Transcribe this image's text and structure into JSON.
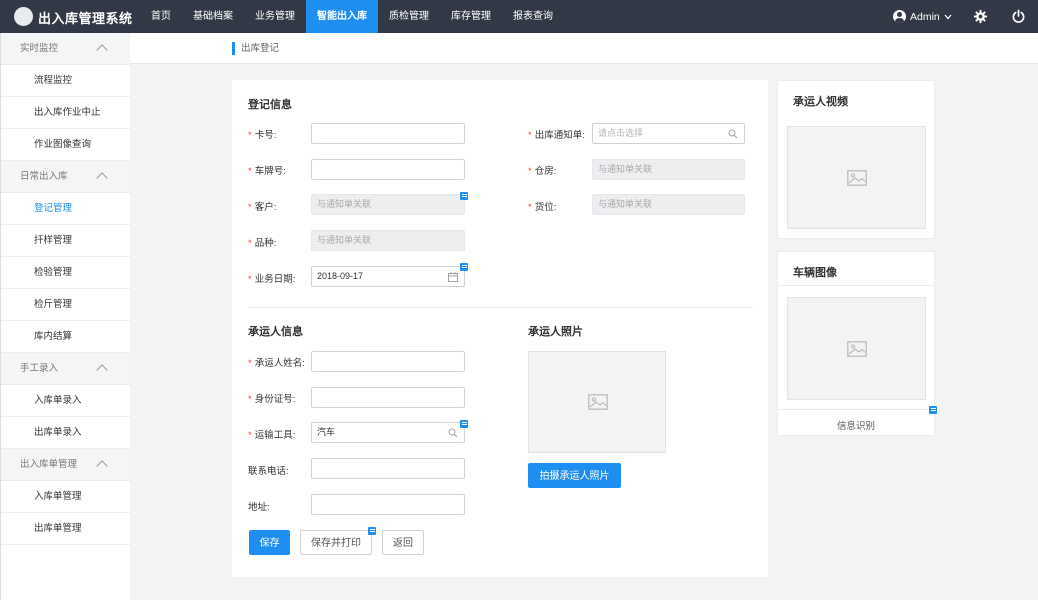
{
  "header": {
    "app_title": "出入库管理系统",
    "nav": [
      {
        "label": "首页",
        "active": false
      },
      {
        "label": "基础档案",
        "active": false
      },
      {
        "label": "业务管理",
        "active": false
      },
      {
        "label": "智能出入库",
        "active": true
      },
      {
        "label": "质检管理",
        "active": false
      },
      {
        "label": "库存管理",
        "active": false
      },
      {
        "label": "报表查询",
        "active": false
      }
    ],
    "user_name": "Admin",
    "user_icon": "user-avatar-icon",
    "settings_icon": "gear-icon",
    "logout_icon": "power-icon"
  },
  "sidebar": {
    "groups": [
      {
        "label": "实时监控",
        "items": [
          "流程监控",
          "出入库作业中止",
          "作业图像查询"
        ]
      },
      {
        "label": "日常出入库",
        "items": [
          "登记管理",
          "扦样管理",
          "检验管理",
          "检斤管理",
          "库内结算"
        ]
      },
      {
        "label": "手工录入",
        "items": [
          "入库单录入",
          "出库单录入"
        ]
      },
      {
        "label": "出入库单管理",
        "items": [
          "入库单管理",
          "出库单管理"
        ]
      }
    ],
    "active_item": "登记管理"
  },
  "breadcrumb": "出库登记",
  "form": {
    "register_title": "登记信息",
    "card_no_label": "卡号:",
    "plate_no_label": "车牌号:",
    "customer_label": "客户:",
    "customer_value": "与通知单关联",
    "variety_label": "品种:",
    "variety_value": "与通知单关联",
    "biz_date_label": "业务日期:",
    "biz_date_value": "2018-09-17",
    "notice_label": "出库通知单:",
    "notice_placeholder": "请点击选择",
    "warehouse_label": "仓房:",
    "warehouse_value": "与通知单关联",
    "location_label": "货位:",
    "location_value": "与通知单关联",
    "carrier_title": "承运人信息",
    "carrier_name_label": "承运人姓名:",
    "id_no_label": "身份证号:",
    "transport_label": "运输工具:",
    "transport_value": "汽车",
    "phone_label": "联系电话:",
    "address_label": "地址:",
    "carrier_photo_title": "承运人照片",
    "take_photo_label": "拍摄承运人照片",
    "save_label": "保存",
    "save_print_label": "保存并打印",
    "back_label": "返回"
  },
  "right_panel": {
    "video_title": "承运人视频",
    "vehicle_title": "车辆图像",
    "recognize_label": "信息识别"
  },
  "colors": {
    "topbar": "#323845",
    "accent": "#1f8ef1",
    "required": "#e74c3c"
  }
}
